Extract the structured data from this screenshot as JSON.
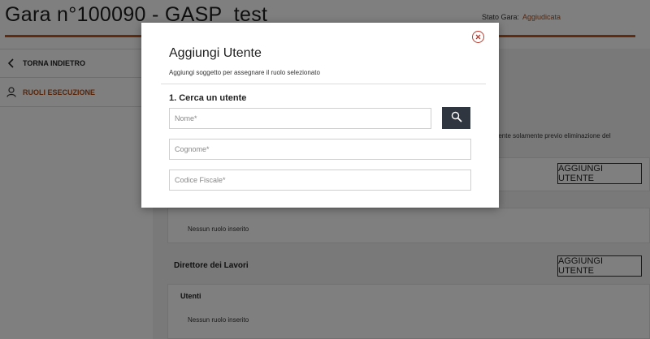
{
  "header": {
    "title": "Gara n°100090 - GASP_test",
    "stato_label": "Stato Gara:",
    "stato_value": "Aggiudicata"
  },
  "sidebar": {
    "back_label": "TORNA INDIETRO",
    "roles_label": "RUOLI ESECUZIONE"
  },
  "content": {
    "hint_fragment": "vo utente solamente previo eliminazione del",
    "add_user_label": "AGGIUNGI UTENTE",
    "empty_roles_text": "Nessun ruolo inserito",
    "section_director": "Direttore dei Lavori",
    "users_heading": "Utenti"
  },
  "modal": {
    "title": "Aggiungi Utente",
    "subtitle": "Aggiungi soggetto per assegnare il ruolo selezionato",
    "step_title": "1. Cerca un utente",
    "name_placeholder": "Nome*",
    "surname_placeholder": "Cognome*",
    "fiscal_code_placeholder": "Codice Fiscale*",
    "close_icon": "close-icon",
    "search_icon": "search-icon"
  },
  "colors": {
    "accent": "#c0561c",
    "accent_text": "#b34a12",
    "search_button": "#2f3640",
    "overlay": "rgba(0,0,0,0.5)"
  }
}
